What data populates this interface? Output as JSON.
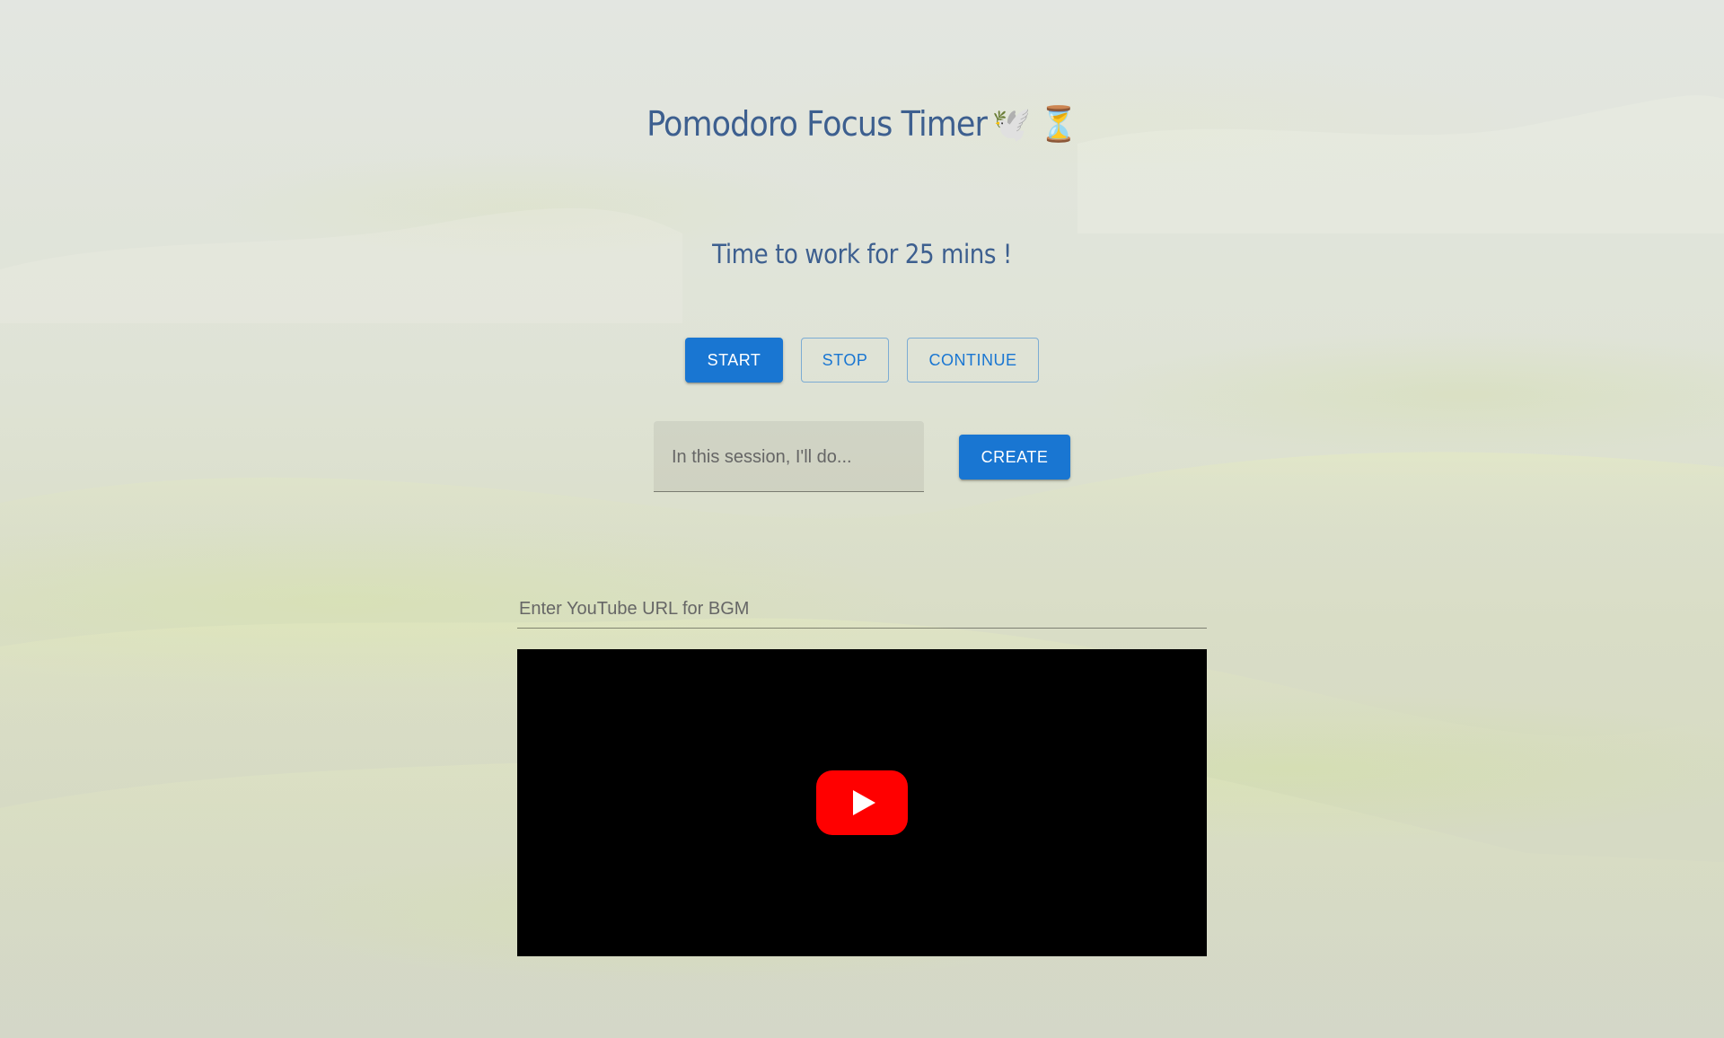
{
  "header": {
    "title": "Pomodoro Focus Timer",
    "title_emoji": "🕊️ ⏳"
  },
  "status": {
    "message": "Time to work for 25 mins !"
  },
  "controls": {
    "start_label": "START",
    "stop_label": "STOP",
    "continue_label": "CONTINUE"
  },
  "session": {
    "placeholder": "In this session, I'll do...",
    "value": "",
    "create_label": "CREATE"
  },
  "bgm": {
    "placeholder": "Enter YouTube URL for BGM",
    "value": ""
  },
  "player": {
    "play_icon": "youtube-play-icon"
  },
  "colors": {
    "accent": "#1976d2",
    "heading": "#3d5f8f",
    "player_bg": "#000000",
    "youtube_red": "#ff0000"
  }
}
